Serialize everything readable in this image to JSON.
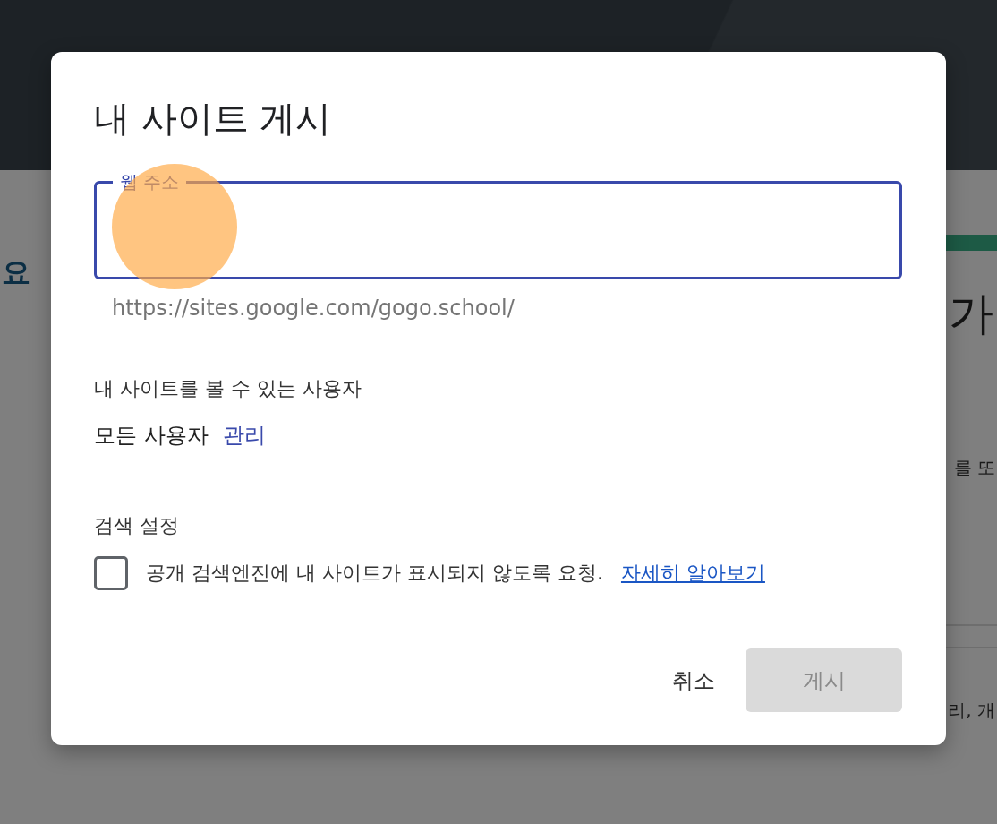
{
  "background_page": {
    "left_text": "요",
    "right_texts": [
      "가",
      "를 또",
      "리, 개"
    ]
  },
  "dialog": {
    "title": "내 사이트 게시",
    "field": {
      "label": "웹 주소",
      "focused": true
    },
    "helper": "https://sites.google.com/gogo.school/",
    "visibility": {
      "heading": "내 사이트를 볼 수 있는 사용자",
      "value": "모든 사용자",
      "link": "관리"
    },
    "search": {
      "heading": "검색 설정",
      "checkbox": {
        "checked": false,
        "label": "공개 검색엔진에 내 사이트가 표시되지 않도록 요청.",
        "link": "자세히 알아보기"
      }
    },
    "buttons": [
      {
        "label": "취소",
        "kind": "text",
        "disabled": false
      },
      {
        "label": "게시",
        "kind": "filled",
        "disabled": true
      }
    ]
  }
}
